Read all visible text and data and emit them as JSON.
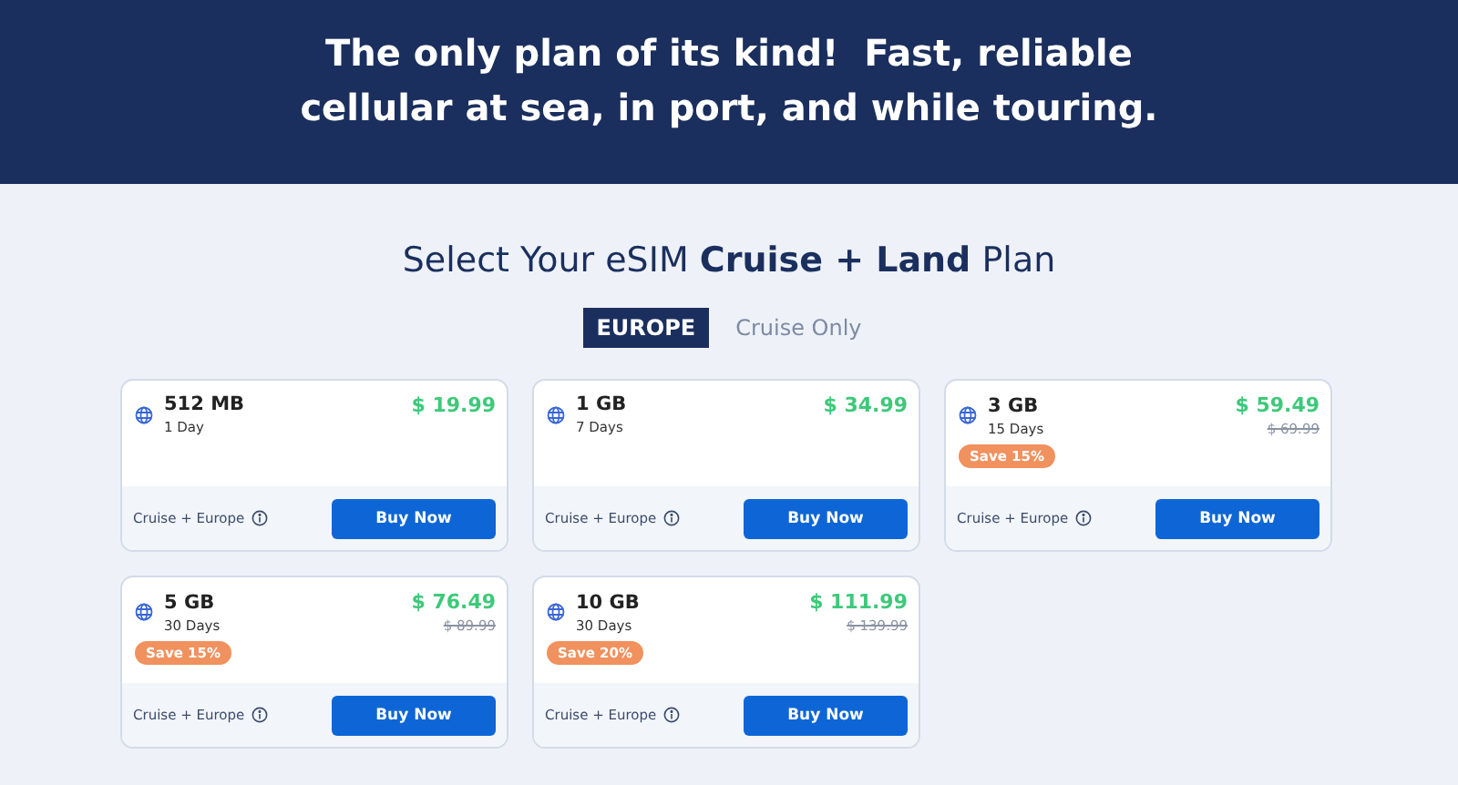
{
  "hero": {
    "headline_lines": [
      "The only plan of its kind!  Fast, reliable",
      "cellular at sea, in port, and while touring."
    ]
  },
  "section_title": "Select Your eSIM **Cruise + Land** Plan",
  "tabs": [
    {
      "label": "EUROPE",
      "selected": true
    },
    {
      "label": "Cruise Only",
      "selected": false
    }
  ],
  "plans": [
    {
      "data": "512 MB",
      "duration": "1 Day",
      "price": "$ 19.99",
      "coverage": "Cruise + Europe",
      "button": "Buy Now"
    },
    {
      "data": "1 GB",
      "duration": "7 Days",
      "price": "$ 34.99",
      "coverage": "Cruise + Europe",
      "button": "Buy Now"
    },
    {
      "data": "3 GB",
      "duration": "15 Days",
      "price": "$ 59.49",
      "old_price": "$ 69.99",
      "badge": "Save 15%",
      "coverage": "Cruise + Europe",
      "button": "Buy Now"
    },
    {
      "data": "5 GB",
      "duration": "30 Days",
      "price": "$ 76.49",
      "old_price": "$ 89.99",
      "badge": "Save 15%",
      "coverage": "Cruise + Europe",
      "button": "Buy Now"
    },
    {
      "data": "10 GB",
      "duration": "30 Days",
      "price": "$ 111.99",
      "old_price": "$ 139.99",
      "badge": "Save 20%",
      "coverage": "Cruise + Europe",
      "button": "Buy Now"
    }
  ]
}
